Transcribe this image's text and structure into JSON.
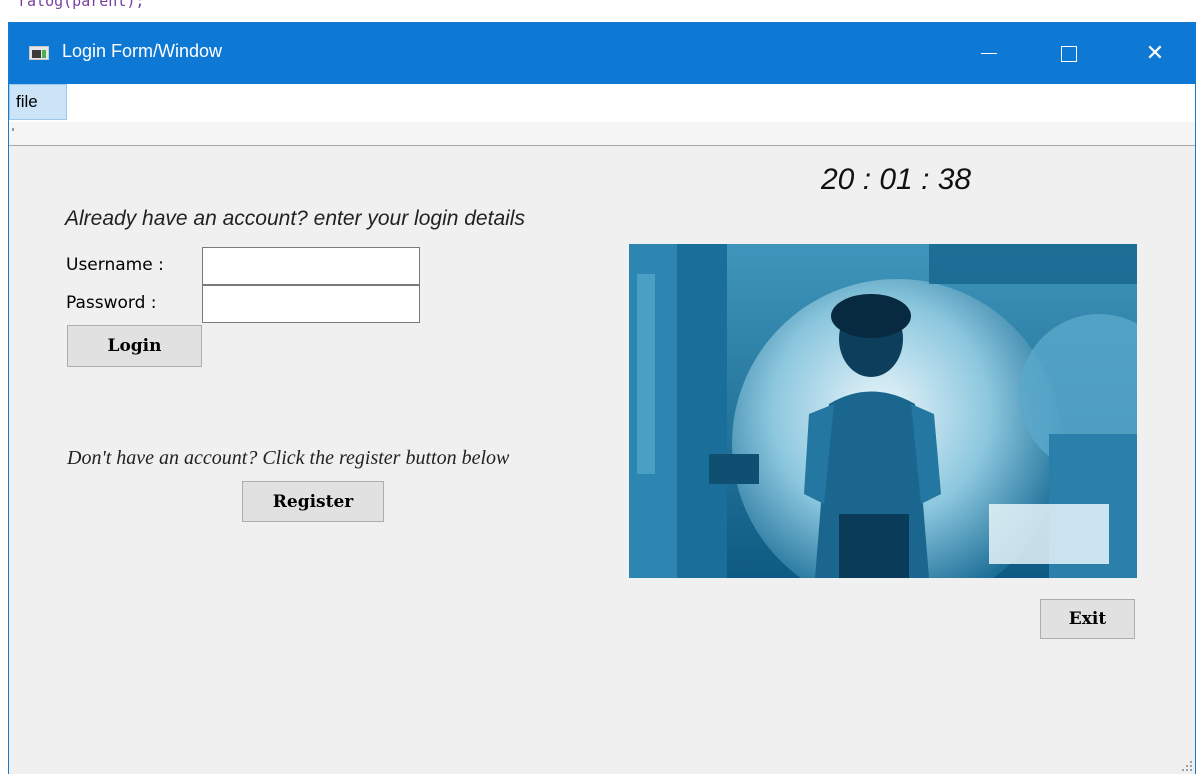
{
  "background": {
    "code_snippet": "ralog(parent);"
  },
  "window": {
    "title": "Login Form/Window",
    "icons": {
      "app": "app-window-icon",
      "minimize": "minimize-icon",
      "maximize": "maximize-icon",
      "close": "close-icon"
    },
    "title_bar_color": "#0e78d5"
  },
  "menu": {
    "file_label": "file"
  },
  "clock": {
    "time": "20 : 01 : 38"
  },
  "login": {
    "heading": "Already have an account? enter your login details",
    "username_label": "Username :",
    "password_label": "Password :",
    "username_value": "",
    "password_value": "",
    "login_button": "Login"
  },
  "register": {
    "heading": "Don't have an account? Click the register button below",
    "register_button": "Register"
  },
  "photo": {
    "description_icon": "profile-photo",
    "tint_color": "#1f6f98"
  },
  "footer": {
    "exit_button": "Exit"
  }
}
